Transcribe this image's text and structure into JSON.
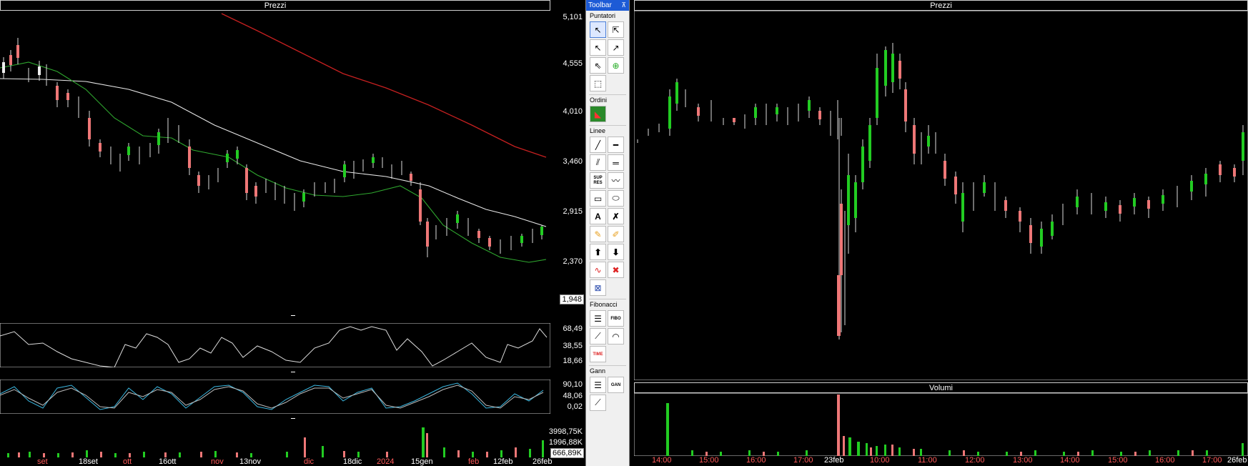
{
  "left_chart": {
    "price_title": "Prezzi",
    "price_axis": [
      "5,101",
      "4,555",
      "4,010",
      "3,460",
      "2,915",
      "2,370"
    ],
    "price_last": "1,948",
    "rsi_axis_top": "68,49",
    "rsi_axis_mid": "38,55",
    "rsi_axis_bot": "18,66",
    "stoch_axis_top": "90,10",
    "stoch_axis_mid": "48,06",
    "stoch_axis_bot": "0,02",
    "vol_axis_top": "3998,75K",
    "vol_axis_mid": "1996,88K",
    "vol_last": "666,89K",
    "x_labels": [
      "set",
      "18set",
      "ott",
      "16ott",
      "nov",
      "13nov",
      "dic",
      "18dic",
      "2024",
      "15gen",
      "feb",
      "12feb",
      "26feb"
    ]
  },
  "toolbar": {
    "title": "Toolbar",
    "pin": "⊼",
    "sections": {
      "pointers": "Puntatori",
      "orders": "Ordini",
      "lines": "Linee",
      "fibonacci": "Fibonacci",
      "gann": "Gann"
    },
    "sup_res": "SUP RES",
    "fibo": "FIBO",
    "gan": "GAN",
    "time": "TIME"
  },
  "right_chart": {
    "price_title": "Prezzi",
    "volume_title": "Volumi",
    "x_labels": [
      "14:00",
      "15:00",
      "16:00",
      "17:00",
      "23feb",
      "10:00",
      "11:00",
      "12:00",
      "13:00",
      "14:00",
      "15:00",
      "16:00",
      "17:00",
      "26feb"
    ]
  }
}
